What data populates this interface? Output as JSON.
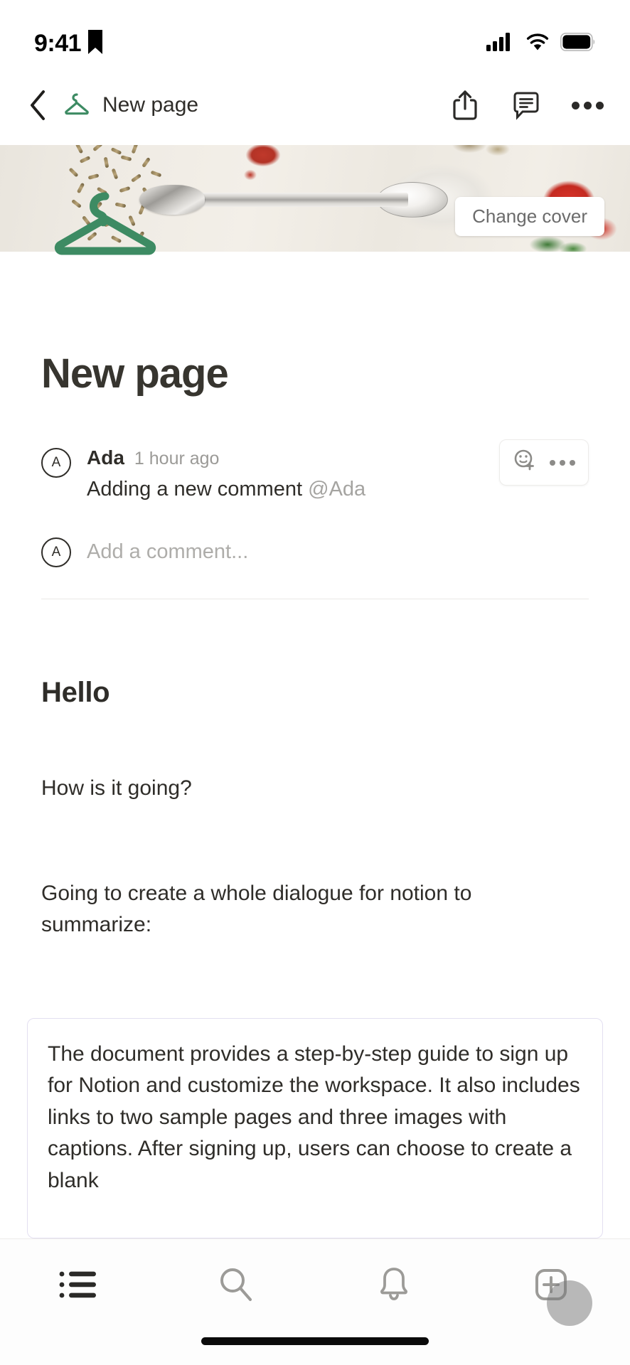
{
  "status_bar": {
    "time": "9:41",
    "bookmark_icon": "bookmark-icon",
    "cellular_icon": "cellular-signal-icon",
    "wifi_icon": "wifi-icon",
    "battery_icon": "battery-full-icon"
  },
  "nav_bar": {
    "back_icon": "chevron-left-icon",
    "page_icon": "clothes-hanger-icon",
    "title": "New page",
    "share_icon": "share-icon",
    "comment_icon": "comment-icon",
    "more_icon": "more-horizontal-icon"
  },
  "cover": {
    "change_cover_label": "Change cover",
    "description": "spoon with salt and cumin seeds on light wooden surface"
  },
  "page": {
    "icon": "clothes-hanger-icon",
    "title": "New page"
  },
  "comments": {
    "items": [
      {
        "avatar_initial": "A",
        "author": "Ada",
        "timestamp": "1 hour ago",
        "body": "Adding a new comment ",
        "mention": "@Ada",
        "reaction_icon": "add-reaction-icon",
        "more_icon": "more-horizontal-icon"
      }
    ],
    "composer": {
      "avatar_initial": "A",
      "placeholder": "Add a comment..."
    }
  },
  "content": {
    "heading": "Hello",
    "paragraph_1": "How is it going?",
    "paragraph_2": "Going to create a whole dialogue for notion to summarize:",
    "summary": "The document provides a step-by-step guide to sign up for Notion and customize the workspace. It also includes links to two sample pages and three images with captions. After signing up, users can choose to create a blank"
  },
  "tab_bar": {
    "tabs": [
      {
        "name": "list",
        "icon": "list-icon",
        "active": true
      },
      {
        "name": "search",
        "icon": "search-icon",
        "active": false
      },
      {
        "name": "notifications",
        "icon": "bell-icon",
        "active": false
      },
      {
        "name": "new-page",
        "icon": "new-page-plus-icon",
        "active": false
      }
    ]
  },
  "colors": {
    "accent_green": "#3D8B63",
    "text_primary": "#2F2D29",
    "text_muted": "#9B9A97",
    "summary_border": "#E3DFF1"
  }
}
